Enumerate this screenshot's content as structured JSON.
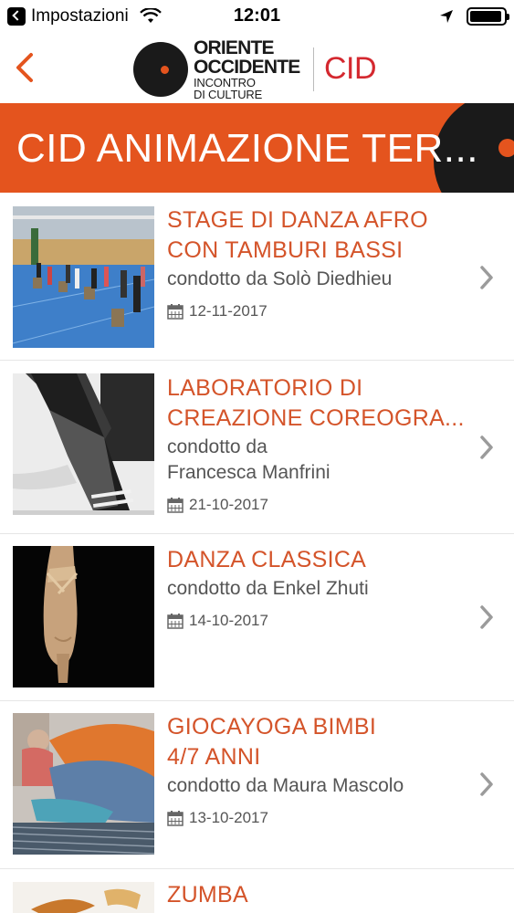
{
  "status_bar": {
    "back_app": "Impostazioni",
    "time": "12:01",
    "battery_level": 0.95
  },
  "header": {
    "logo_line1": "ORIENTE",
    "logo_line2": "OCCIDENTE",
    "logo_line3": "INCONTRO",
    "logo_line4": "DI CULTURE",
    "logo_suffix": "CID"
  },
  "banner": {
    "title": "CID ANIMAZIONE TER..."
  },
  "colors": {
    "accent": "#e4541e",
    "title": "#d4542a",
    "brand_red": "#d4282f"
  },
  "events": [
    {
      "title_lines": [
        "STAGE DI DANZA AFRO",
        "CON TAMBURI BASSI"
      ],
      "author_lines": [
        "condotto da Solò Diedhieu"
      ],
      "date": "12-11-2017"
    },
    {
      "title_lines": [
        "LABORATORIO DI",
        "CREAZIONE COREOGRA..."
      ],
      "author_lines": [
        "condotto da",
        "Francesca Manfrini"
      ],
      "date": "21-10-2017"
    },
    {
      "title_lines": [
        "DANZA CLASSICA"
      ],
      "author_lines": [
        "condotto da Enkel Zhuti"
      ],
      "date": "14-10-2017"
    },
    {
      "title_lines": [
        "GIOCAYOGA BIMBI",
        "4/7 ANNI"
      ],
      "author_lines": [
        "condotto da Maura Mascolo"
      ],
      "date": "13-10-2017"
    },
    {
      "title_lines": [
        "ZUMBA"
      ]
    }
  ]
}
